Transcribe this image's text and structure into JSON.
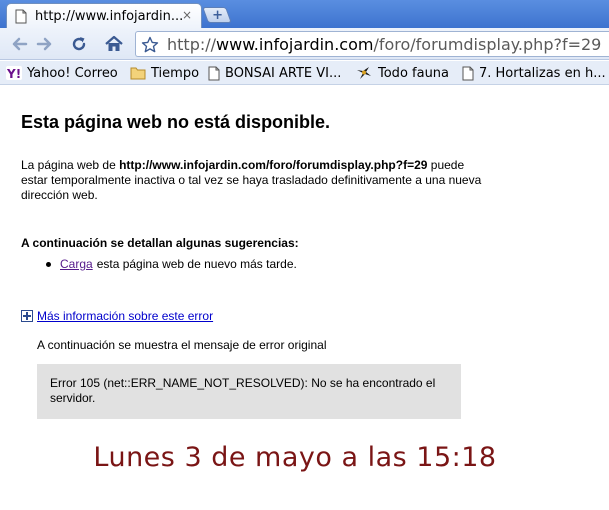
{
  "tab": {
    "title": "http://www.infojardin....",
    "close": "×",
    "new_tab": "+"
  },
  "toolbar": {
    "url_scheme": "http://",
    "url_host": "www.infojardin.com",
    "url_path": "/foro/forumdisplay.php?f=29"
  },
  "bookmarks": [
    {
      "label": "Yahoo! Correo",
      "icon": "yahoo-icon"
    },
    {
      "label": "Tiempo",
      "icon": "folder-icon"
    },
    {
      "label": "BONSAI ARTE VI...",
      "icon": "page-icon"
    },
    {
      "label": "Todo fauna",
      "icon": "bird-icon"
    },
    {
      "label": "7. Hortalizas en h...",
      "icon": "page-icon"
    }
  ],
  "error_page": {
    "title": "Esta página web no está disponible.",
    "desc_prefix": "La página web de ",
    "desc_url": "http://www.infojardin.com/foro/forumdisplay.php?f=29",
    "desc_suffix": " puede estar temporalmente inactiva o tal vez se haya trasladado definitivamente a una nueva dirección web.",
    "suggestions_heading": "A continuación se detallan algunas sugerencias:",
    "suggestion_link": "Carga",
    "suggestion_text": "esta página web de nuevo más tarde.",
    "more_info_link": "Más información sobre este error",
    "original_message_label": "A continuación se muestra el mensaje de error original",
    "error_box": "Error 105 (net::ERR_NAME_NOT_RESOLVED): No se ha encontrado el servidor."
  },
  "caption": "Lunes 3 de mayo a las 15:18",
  "colors": {
    "caption": "#7a1515",
    "visited_link": "#551a8b",
    "link": "#0000cc",
    "error_box_bg": "#e1e1e1"
  }
}
